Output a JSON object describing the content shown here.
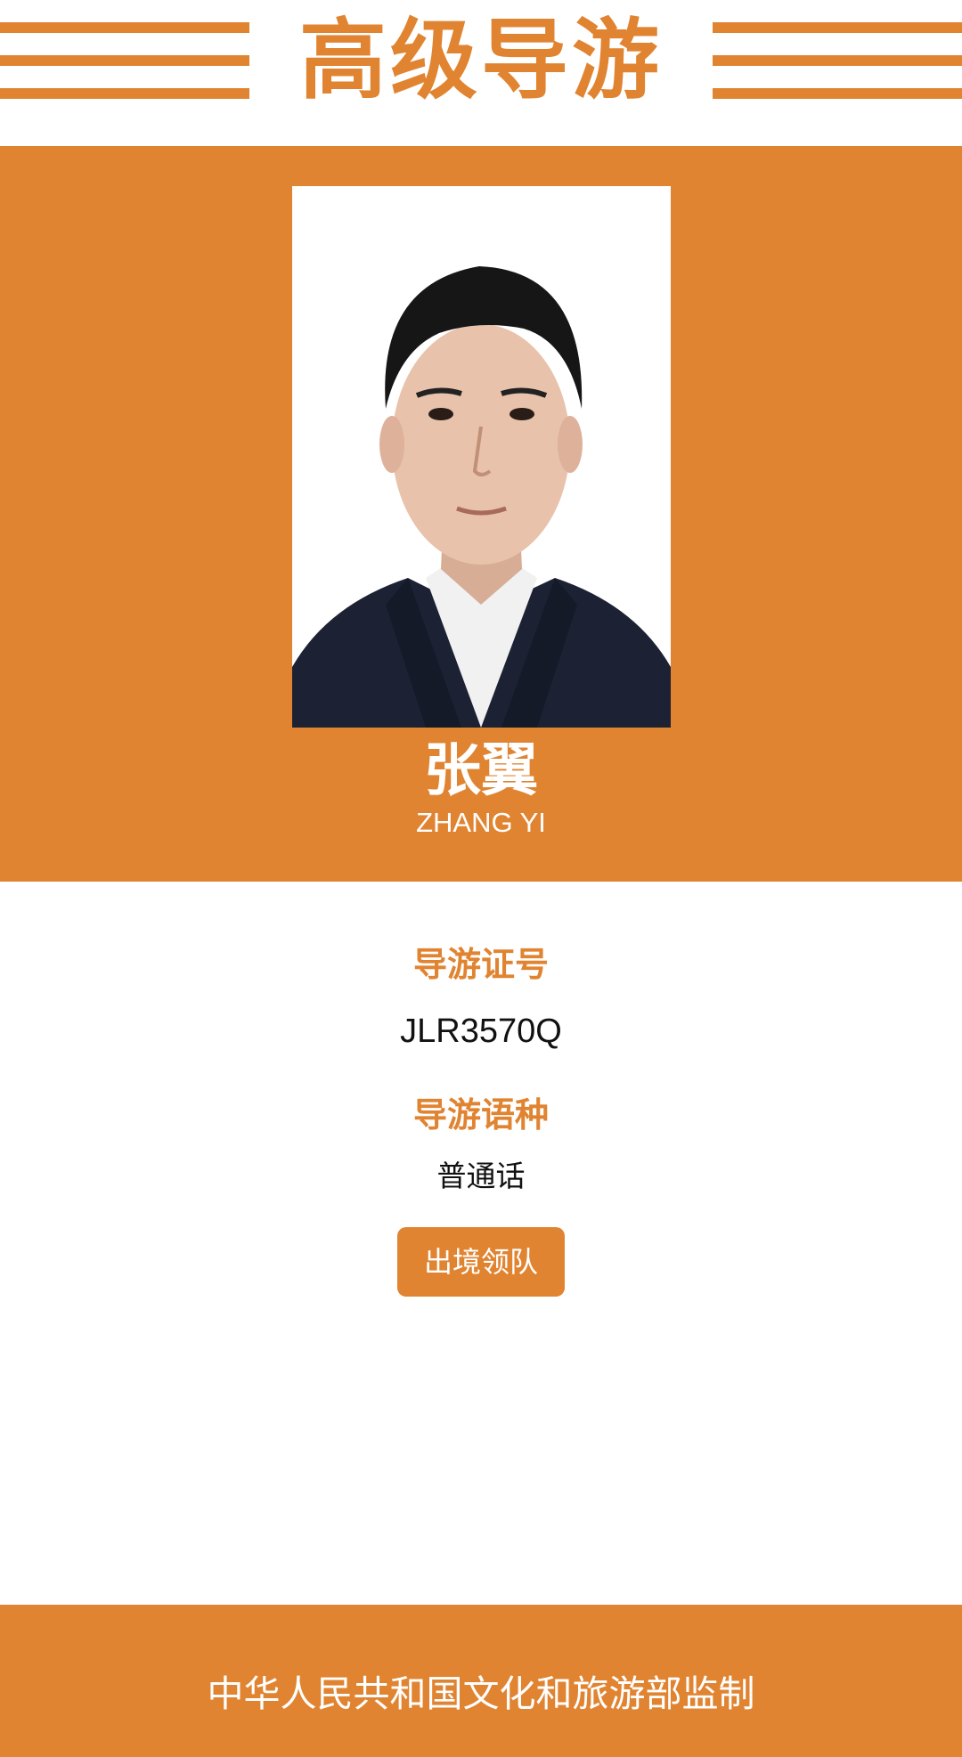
{
  "header": {
    "title": "高级导游"
  },
  "profile": {
    "name_cn": "张翼",
    "name_en": "ZHANG YI"
  },
  "info": {
    "cert_label": "导游证号",
    "cert_value": "JLR3570Q",
    "language_label": "导游语种",
    "language_value": "普通话",
    "badge": "出境领队"
  },
  "footer": {
    "text": "中华人民共和国文化和旅游部监制"
  },
  "colors": {
    "accent": "#e08431",
    "background": "#ffffff",
    "text_dark": "#111111"
  }
}
